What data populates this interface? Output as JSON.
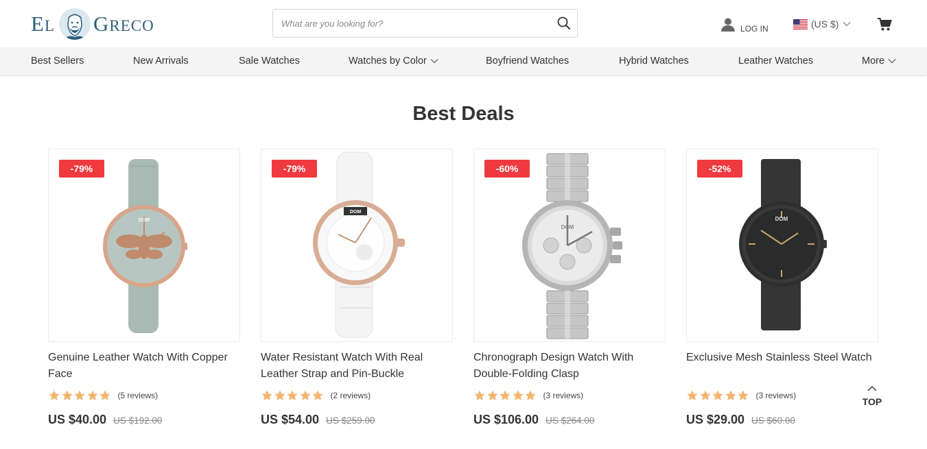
{
  "header": {
    "logo_part1_initial": "E",
    "logo_part1_rest": "L",
    "logo_part2_initial": "G",
    "logo_part2_rest": "RECO",
    "search_placeholder": "What are you looking for?",
    "login_label": "LOG IN",
    "currency_label": "(US $)"
  },
  "nav": {
    "items": [
      {
        "label": "Best Sellers"
      },
      {
        "label": "New Arrivals"
      },
      {
        "label": "Sale Watches"
      },
      {
        "label": "Watches by Color"
      },
      {
        "label": "Boyfriend Watches"
      },
      {
        "label": "Hybrid Watches"
      },
      {
        "label": "Leather Watches"
      },
      {
        "label": "More"
      }
    ]
  },
  "section": {
    "title": "Best Deals"
  },
  "products": [
    {
      "badge": "-79%",
      "name": "Genuine Leather Watch With Copper Face",
      "rating": 5,
      "reviews": "(5 reviews)",
      "price": "US $40.00",
      "old_price": "US $192.00"
    },
    {
      "badge": "-79%",
      "name": "Water Resistant Watch With Real Leather Strap and Pin-Buckle",
      "rating": 5,
      "reviews": "(2 reviews)",
      "price": "US $54.00",
      "old_price": "US $259.00"
    },
    {
      "badge": "-60%",
      "name": "Chronograph Design Watch With Double-Folding Clasp",
      "rating": 5,
      "reviews": "(3 reviews)",
      "price": "US $106.00",
      "old_price": "US $264.00"
    },
    {
      "badge": "-52%",
      "name": "Exclusive Mesh Stainless Steel Watch",
      "rating": 5,
      "reviews": "(3 reviews)",
      "price": "US $29.00",
      "old_price": "US $60.00"
    }
  ],
  "watch_dial_brand": "DOM",
  "back_to_top": {
    "label": "TOP"
  },
  "colors": {
    "brand": "#2e5f7a",
    "badge": "#ef3a3f",
    "star": "#f5b26b",
    "nav_bg": "#f4f4f4"
  }
}
